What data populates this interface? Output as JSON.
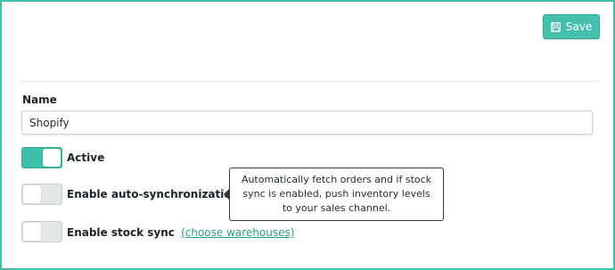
{
  "toolbar": {
    "save_label": "Save",
    "save_icon": "floppy-disk-icon"
  },
  "form": {
    "name_label": "Name",
    "name_value": "Shopify",
    "active": {
      "label": "Active",
      "enabled": true
    },
    "auto_sync": {
      "label": "Enable auto-synchronization",
      "enabled": false,
      "help_icon": "question-circle-icon",
      "tooltip": "Automatically fetch orders and if stock sync is enabled, push inventory levels to your sales channel."
    },
    "stock_sync": {
      "label": "Enable stock sync",
      "enabled": false,
      "link": "(choose warehouses)"
    }
  },
  "colors": {
    "accent": "#3dbfa8",
    "border": "#3dbfa8",
    "link": "#2a9b87",
    "toggle_off": "#e4e7e8"
  }
}
